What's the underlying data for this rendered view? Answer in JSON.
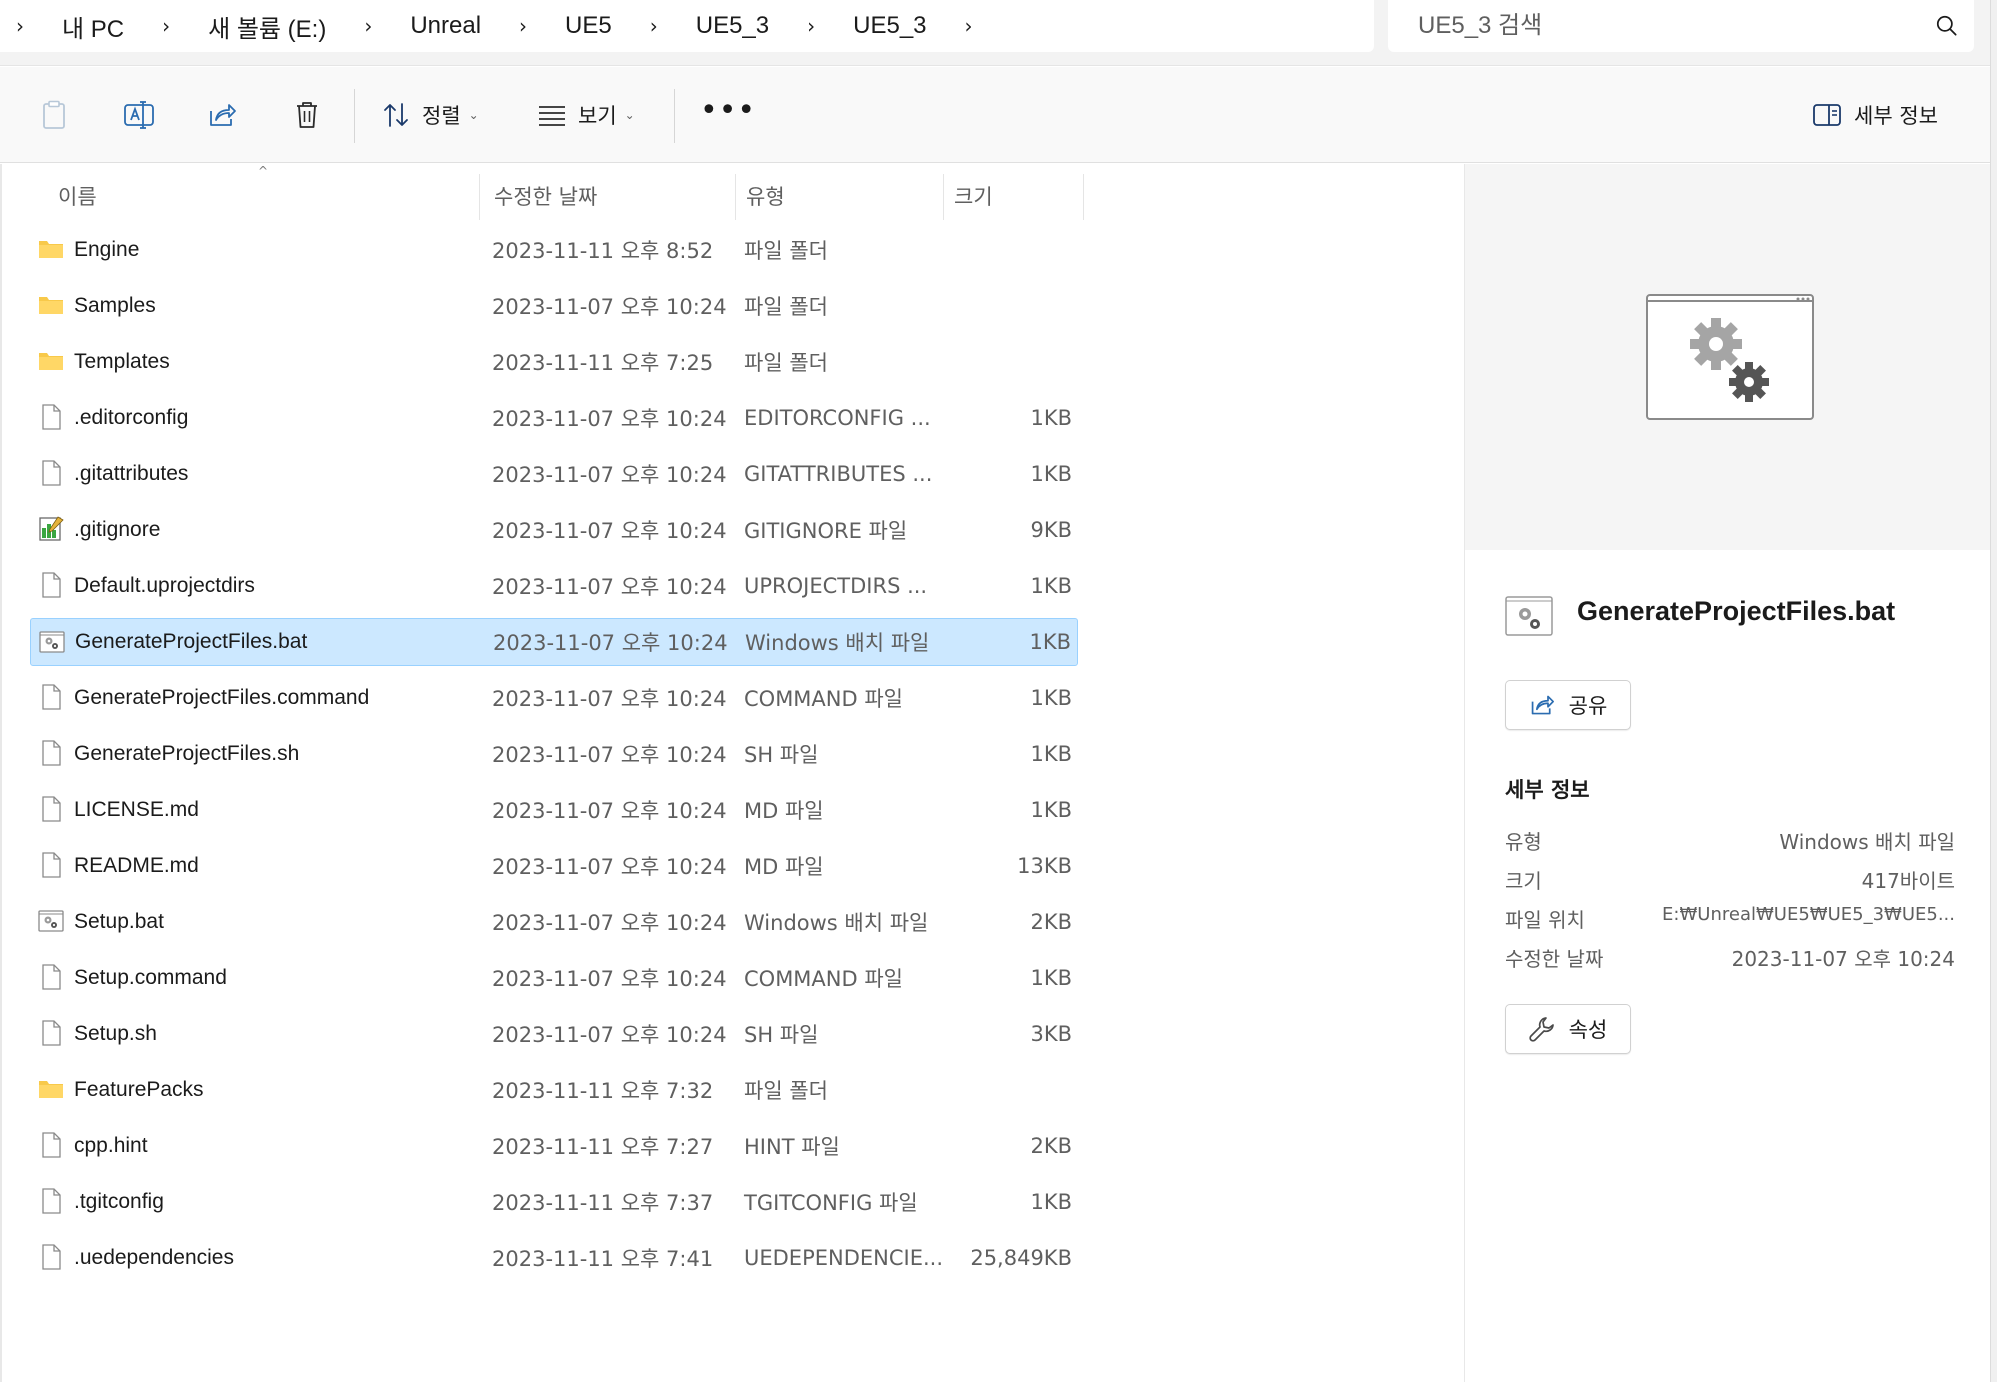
{
  "breadcrumb": {
    "items": [
      "내 PC",
      "새 볼륨 (E:)",
      "Unreal",
      "UE5",
      "UE5_3",
      "UE5_3"
    ]
  },
  "search": {
    "placeholder": "UE5_3 검색"
  },
  "toolbar": {
    "sort_label": "정렬",
    "view_label": "보기",
    "more_label": "•••",
    "details_label": "세부 정보"
  },
  "columns": {
    "name": "이름",
    "date": "수정한 날짜",
    "type": "유형",
    "size": "크기"
  },
  "files": [
    {
      "name": "Engine",
      "date": "2023-11-11 오후 8:52",
      "type": "파일 폴더",
      "size": "",
      "icon": "folder-icon"
    },
    {
      "name": "Samples",
      "date": "2023-11-07 오후 10:24",
      "type": "파일 폴더",
      "size": "",
      "icon": "folder-icon"
    },
    {
      "name": "Templates",
      "date": "2023-11-11 오후 7:25",
      "type": "파일 폴더",
      "size": "",
      "icon": "folder-icon"
    },
    {
      "name": ".editorconfig",
      "date": "2023-11-07 오후 10:24",
      "type": "EDITORCONFIG ...",
      "size": "1KB",
      "icon": "file-icon"
    },
    {
      "name": ".gitattributes",
      "date": "2023-11-07 오후 10:24",
      "type": "GITATTRIBUTES ...",
      "size": "1KB",
      "icon": "file-icon"
    },
    {
      "name": ".gitignore",
      "date": "2023-11-07 오후 10:24",
      "type": "GITIGNORE 파일",
      "size": "9KB",
      "icon": "notepad-icon"
    },
    {
      "name": "Default.uprojectdirs",
      "date": "2023-11-07 오후 10:24",
      "type": "UPROJECTDIRS ...",
      "size": "1KB",
      "icon": "file-icon"
    },
    {
      "name": "GenerateProjectFiles.bat",
      "date": "2023-11-07 오후 10:24",
      "type": "Windows 배치 파일",
      "size": "1KB",
      "icon": "batch-icon",
      "selected": true
    },
    {
      "name": "GenerateProjectFiles.command",
      "date": "2023-11-07 오후 10:24",
      "type": "COMMAND 파일",
      "size": "1KB",
      "icon": "file-icon"
    },
    {
      "name": "GenerateProjectFiles.sh",
      "date": "2023-11-07 오후 10:24",
      "type": "SH 파일",
      "size": "1KB",
      "icon": "file-icon"
    },
    {
      "name": "LICENSE.md",
      "date": "2023-11-07 오후 10:24",
      "type": "MD 파일",
      "size": "1KB",
      "icon": "file-icon"
    },
    {
      "name": "README.md",
      "date": "2023-11-07 오후 10:24",
      "type": "MD 파일",
      "size": "13KB",
      "icon": "file-icon"
    },
    {
      "name": "Setup.bat",
      "date": "2023-11-07 오후 10:24",
      "type": "Windows 배치 파일",
      "size": "2KB",
      "icon": "batch-icon"
    },
    {
      "name": "Setup.command",
      "date": "2023-11-07 오후 10:24",
      "type": "COMMAND 파일",
      "size": "1KB",
      "icon": "file-icon"
    },
    {
      "name": "Setup.sh",
      "date": "2023-11-07 오후 10:24",
      "type": "SH 파일",
      "size": "3KB",
      "icon": "file-icon"
    },
    {
      "name": "FeaturePacks",
      "date": "2023-11-11 오후 7:32",
      "type": "파일 폴더",
      "size": "",
      "icon": "folder-icon"
    },
    {
      "name": "cpp.hint",
      "date": "2023-11-11 오후 7:27",
      "type": "HINT 파일",
      "size": "2KB",
      "icon": "file-icon"
    },
    {
      "name": ".tgitconfig",
      "date": "2023-11-11 오후 7:37",
      "type": "TGITCONFIG 파일",
      "size": "1KB",
      "icon": "file-icon"
    },
    {
      "name": ".uedependencies",
      "date": "2023-11-11 오후 7:41",
      "type": "UEDEPENDENCIE...",
      "size": "25,849KB",
      "icon": "file-icon"
    }
  ],
  "details": {
    "title": "GenerateProjectFiles.bat",
    "share_label": "공유",
    "section_heading": "세부 정보",
    "props": [
      {
        "key": "유형",
        "value": "Windows 배치 파일"
      },
      {
        "key": "크기",
        "value": "417바이트"
      },
      {
        "key": "파일 위치",
        "value": "E:₩Unreal₩UE5₩UE5_3₩UE5..."
      },
      {
        "key": "수정한 날짜",
        "value": "2023-11-07 오후 10:24"
      }
    ],
    "properties_label": "속성"
  },
  "colors": {
    "selection": "#cce8ff",
    "selection_border": "#99d1ff",
    "folder": "#f8c94a",
    "accent": "#0067c0"
  }
}
